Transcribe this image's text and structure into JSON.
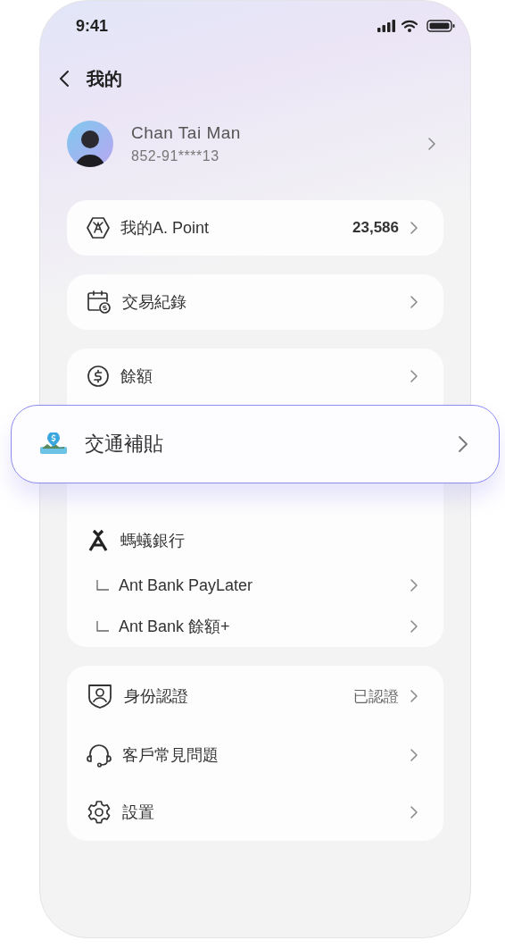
{
  "status_bar": {
    "time": "9:41"
  },
  "header": {
    "title": "我的"
  },
  "profile": {
    "name": "Chan Tai Man",
    "phone": "852-91****13"
  },
  "groups": [
    {
      "items": [
        {
          "kind": "row",
          "label": "我的A. Point",
          "value": "23,586"
        }
      ]
    },
    {
      "items": [
        {
          "kind": "row",
          "label": "交易紀錄"
        }
      ]
    },
    {
      "items": [
        {
          "kind": "row",
          "label": "餘額"
        },
        {
          "kind": "covered"
        },
        {
          "kind": "section",
          "label": "螞蟻銀行"
        },
        {
          "kind": "sub",
          "label": "Ant Bank PayLater"
        },
        {
          "kind": "sub",
          "label": "Ant Bank 餘額+"
        }
      ]
    },
    {
      "items": [
        {
          "kind": "row",
          "label": "身份認證",
          "value": "已認證"
        },
        {
          "kind": "row",
          "label": "客戶常見問題"
        },
        {
          "kind": "row",
          "label": "設置"
        }
      ]
    }
  ],
  "callout": {
    "label": "交通補貼"
  }
}
